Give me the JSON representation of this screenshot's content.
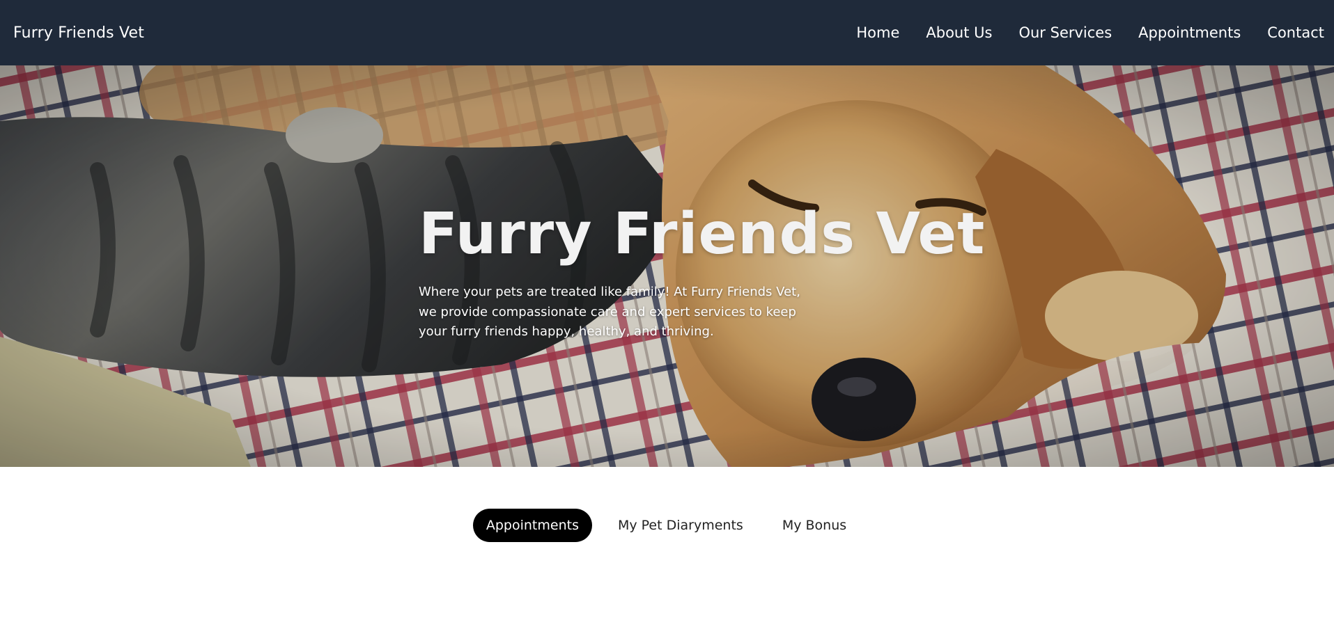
{
  "header": {
    "brand": "Furry Friends Vet",
    "nav": [
      "Home",
      "About Us",
      "Our Services",
      "Appointments",
      "Contact"
    ]
  },
  "hero": {
    "title": "Furry Friends Vet",
    "text": "Where your pets are treated like family! At Furry Friends Vet, we provide compassionate care and expert services to keep your furry friends happy, healthy, and thriving.",
    "image": "sleeping-dog-and-cat-on-plaid-blanket"
  },
  "tabs": {
    "items": [
      "Appointments",
      "My Pet Diaryments",
      "My Bonus"
    ],
    "active": "Appointments"
  },
  "colors": {
    "header_bg": "#1f2a3a",
    "active_tab_bg": "#000000",
    "text_light": "#ffffff"
  }
}
